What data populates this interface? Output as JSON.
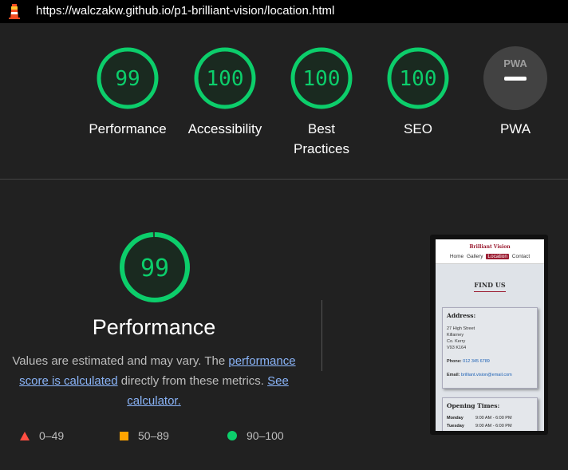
{
  "header": {
    "url": "https://walczakw.github.io/p1-brilliant-vision/location.html"
  },
  "colors": {
    "pass": "#0cce6b",
    "average": "#ffa400",
    "fail": "#ff4e42",
    "pwa_gray": "#9e9e9e"
  },
  "gauges": [
    {
      "score": "99",
      "label": "Performance"
    },
    {
      "score": "100",
      "label": "Accessibility"
    },
    {
      "score": "100",
      "label": "Best Practices"
    },
    {
      "score": "100",
      "label": "SEO"
    },
    {
      "label": "PWA",
      "badge": "PWA"
    }
  ],
  "main": {
    "score": "99",
    "score_value": 99,
    "title": "Performance",
    "desc_1": "Values are estimated and may vary. The ",
    "link_1": "performance score is calculated",
    "desc_2": " directly from these metrics. ",
    "link_2": "See calculator."
  },
  "legend": [
    {
      "icon": "triangle-icon",
      "range": "0–49"
    },
    {
      "icon": "square-icon",
      "range": "50–89"
    },
    {
      "icon": "circle-icon",
      "range": "90–100"
    }
  ],
  "screenshot": {
    "brand": "Brilliant Vision",
    "nav": [
      "Home",
      "Gallery",
      "Location",
      "Contact"
    ],
    "heading": "FIND US",
    "address_heading": "Address:",
    "address_lines": [
      "27 High Street",
      "Killarney",
      "Co. Kerry",
      "V93 K164"
    ],
    "phone_label": "Phone:",
    "phone": "012 345 6789",
    "email_label": "Email:",
    "email": "brilliant.vision@email.com",
    "hours_heading": "Opening Times:",
    "hours": [
      {
        "day": "Monday",
        "time": "9:00 AM - 6:00 PM"
      },
      {
        "day": "Tuesday",
        "time": "9:00 AM - 6:00 PM"
      }
    ]
  }
}
